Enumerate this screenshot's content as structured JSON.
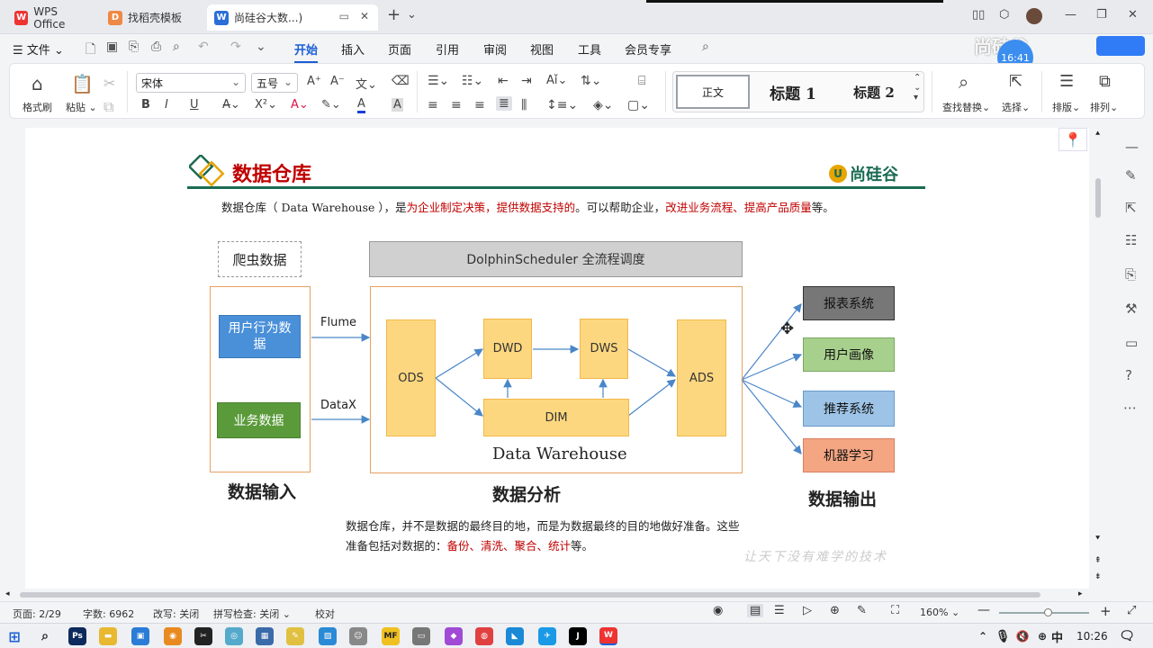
{
  "tabs": [
    {
      "label": "WPS Office",
      "icon": "wps-logo-icon"
    },
    {
      "label": "找稻壳模板",
      "icon": "docer-icon"
    },
    {
      "label": "尚硅谷大数...)",
      "icon": "word-doc-icon"
    }
  ],
  "menu": {
    "file": "文件",
    "items": [
      "开始",
      "插入",
      "页面",
      "引用",
      "审阅",
      "视图",
      "工具",
      "会员专享"
    ],
    "active": "开始"
  },
  "ribbon": {
    "format_painter": "格式刷",
    "paste": "粘贴",
    "font_name": "宋体",
    "font_size": "五号",
    "bold": "B",
    "italic": "I",
    "underline": "U",
    "styles": [
      "正文",
      "标题 1",
      "标题 2"
    ],
    "find_replace": "查找替换",
    "select": "选择",
    "layout": "排版",
    "arrange": "排列"
  },
  "watermark": {
    "logo": "尚硅谷",
    "time": "16:41",
    "slogan": "让天下没有难学的技术"
  },
  "slide": {
    "title": "数据仓库",
    "brand": "尚硅谷",
    "intro": {
      "p1": "数据仓库（ Data Warehouse ），是",
      "r1": "为企业制定决策，提供数据支持的",
      "p2": "。可以帮助企业，",
      "r2": "改进业务流程、提高产品质量",
      "p3": "等。"
    },
    "crawler": "爬虫数据",
    "scheduler": "DolphinScheduler 全流程调度",
    "sources": [
      "用户行为数据",
      "业务数据"
    ],
    "flume": "Flume",
    "datax": "DataX",
    "layers": {
      "ods": "ODS",
      "dwd": "DWD",
      "dws": "DWS",
      "dim": "DIM",
      "ads": "ADS"
    },
    "warehouse": "Data Warehouse",
    "outputs": [
      "报表系统",
      "用户画像",
      "推荐系统",
      "机器学习"
    ],
    "section_labels": [
      "数据输入",
      "数据分析",
      "数据输出"
    ],
    "note": {
      "line1": "数据仓库，并不是数据的最终目的地，而是为数据最终的目的地做好准备。这些",
      "line2_pre": "准备包括对数据的：",
      "line2_red": "备份、清洗、聚合、统计",
      "line2_post": "等。"
    }
  },
  "status": {
    "page": "页面: 2/29",
    "words": "字数: 6962",
    "revise": "改写: 关闭",
    "spell": "拼写检查: 关闭",
    "proof": "校对",
    "zoom": "160%"
  },
  "taskbar": {
    "ime": "中",
    "time": "10:26"
  },
  "colors": {
    "accent": "#1a5fd6",
    "brand_green": "#1a6b52",
    "title_red": "#c00000",
    "warehouse_yellow": "#fcd77f"
  }
}
